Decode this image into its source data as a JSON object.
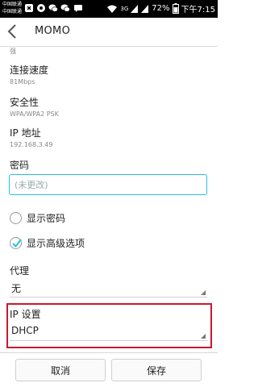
{
  "status_bar": {
    "carrier_1": "中国联通",
    "carrier_2": "中国联通",
    "network": "3G",
    "battery": "72%",
    "time": "下午7:15"
  },
  "action_bar": {
    "title": "MOMO"
  },
  "signal": {
    "value": "强"
  },
  "link_speed": {
    "label": "连接速度",
    "value": "81Mbps"
  },
  "security": {
    "label": "安全性",
    "value": "WPA/WPA2 PSK"
  },
  "ip_address": {
    "label": "IP 地址",
    "value": "192.168.3.49"
  },
  "password": {
    "label": "密码",
    "placeholder": "(未更改)",
    "value": ""
  },
  "show_password": {
    "label": "显示密码",
    "checked": false
  },
  "show_advanced": {
    "label": "显示高级选项",
    "checked": true
  },
  "proxy": {
    "label": "代理",
    "selected": "无"
  },
  "ip_settings": {
    "label": "IP 设置",
    "selected": "DHCP"
  },
  "buttons": {
    "cancel": "取消",
    "save": "保存"
  },
  "colors": {
    "accent": "#27c0e3",
    "highlight": "#c8192e"
  }
}
